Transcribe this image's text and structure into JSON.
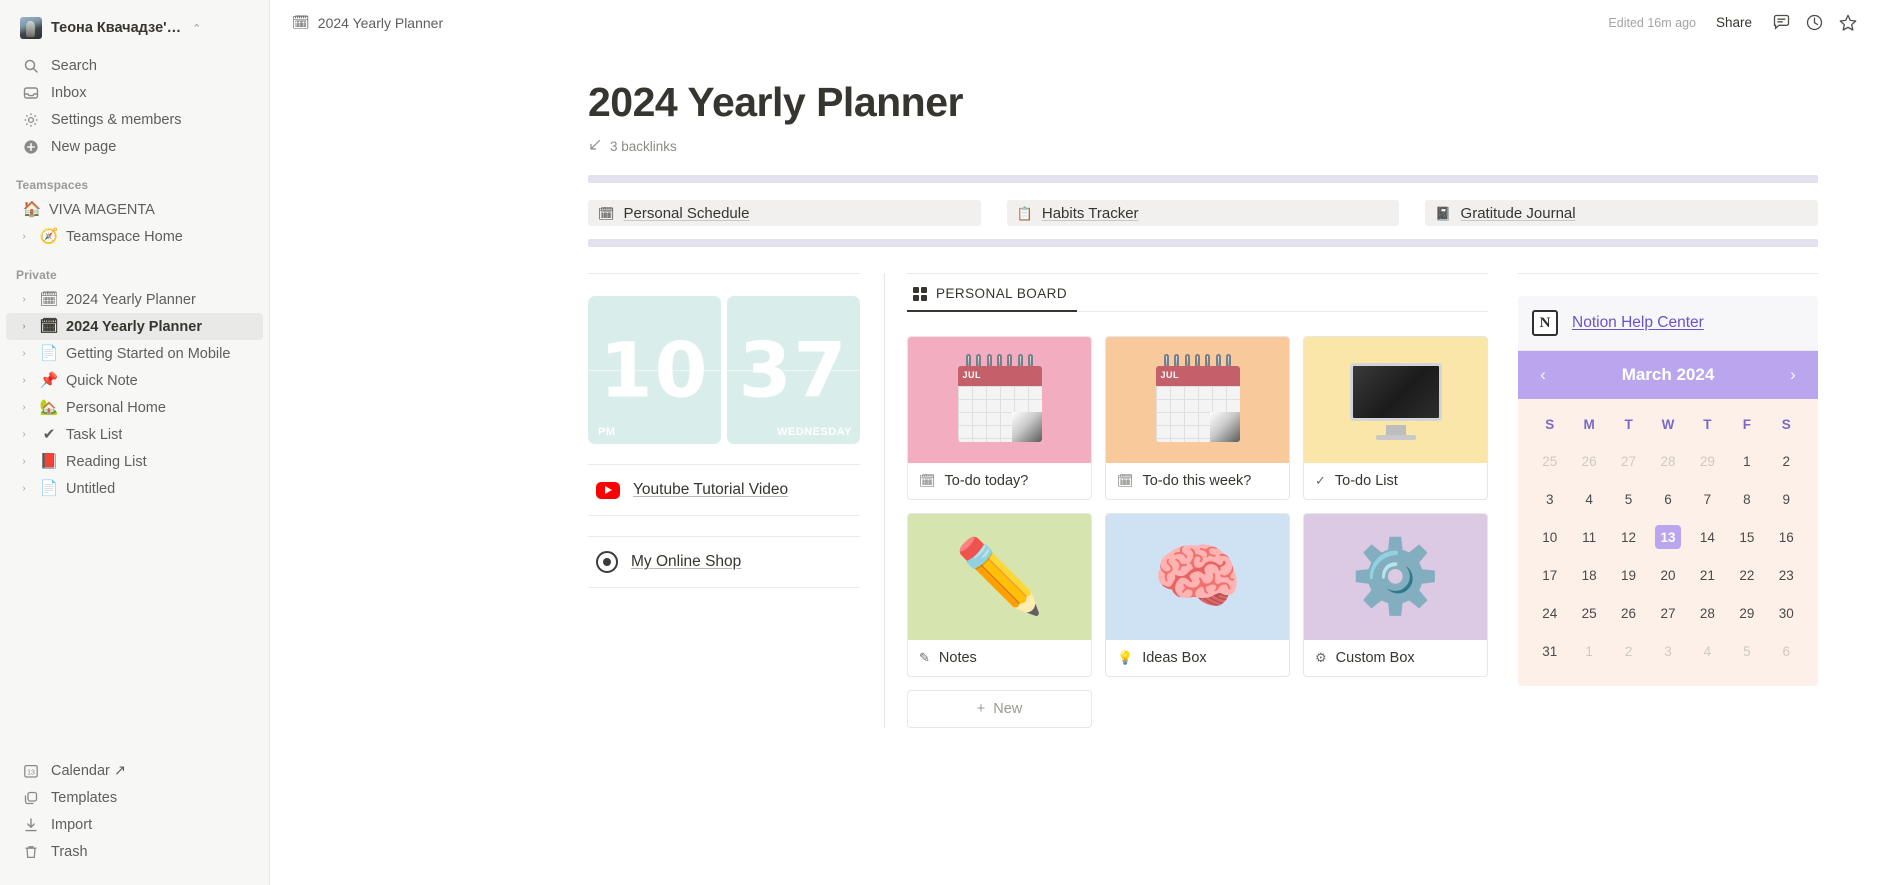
{
  "sidebar": {
    "workspace": {
      "name": "Теона Квачадзе'…",
      "caret": "⌃⌄"
    },
    "nav": [
      {
        "label": "Search",
        "icon": "search-icon"
      },
      {
        "label": "Inbox",
        "icon": "inbox-icon"
      },
      {
        "label": "Settings & members",
        "icon": "gear-icon"
      },
      {
        "label": "New page",
        "icon": "plus-circle-icon"
      }
    ],
    "teamspaces_title": "Teamspaces",
    "teamspaces": [
      {
        "label": "VIVA MAGENTA",
        "emoji": "🏠",
        "arrow": false
      },
      {
        "label": "Teamspace Home",
        "emoji": "🧭",
        "arrow": true
      }
    ],
    "private_title": "Private",
    "private": [
      {
        "label": "2024 Yearly Planner",
        "emoji": "🗓",
        "arrow": true,
        "active": false
      },
      {
        "label": "2024 Yearly Planner",
        "emoji": "🗓",
        "arrow": true,
        "active": true
      },
      {
        "label": "Getting Started on Mobile",
        "emoji": "📄",
        "arrow": true,
        "active": false
      },
      {
        "label": "Quick Note",
        "emoji": "📌",
        "arrow": true,
        "active": false
      },
      {
        "label": "Personal Home",
        "emoji": "🏡",
        "arrow": true,
        "active": false
      },
      {
        "label": "Task List",
        "emoji": "✔",
        "arrow": true,
        "active": false
      },
      {
        "label": "Reading List",
        "emoji": "📕",
        "arrow": true,
        "active": false
      },
      {
        "label": "Untitled",
        "emoji": "📄",
        "arrow": true,
        "active": false
      }
    ],
    "bottom": [
      {
        "label": "Calendar ↗",
        "icon": "calendar-13-icon"
      },
      {
        "label": "Templates",
        "icon": "templates-icon"
      },
      {
        "label": "Import",
        "icon": "import-icon"
      },
      {
        "label": "Trash",
        "icon": "trash-icon"
      }
    ]
  },
  "topbar": {
    "breadcrumb": "2024 Yearly Planner",
    "breadcrumb_emoji": "🗓",
    "edited": "Edited 16m ago",
    "share": "Share"
  },
  "page": {
    "title": "2024 Yearly Planner",
    "backlinks": "3 backlinks",
    "nav_cards": [
      {
        "label": "Personal Schedule",
        "emoji": "🗓"
      },
      {
        "label": "Habits Tracker",
        "emoji": "📋"
      },
      {
        "label": "Gratitude Journal",
        "emoji": "📓"
      }
    ]
  },
  "clock": {
    "hours": "10",
    "minutes": "37",
    "meridiem": "PM",
    "weekday": "WEDNESDAY"
  },
  "links": [
    {
      "label": "Youtube Tutorial Video",
      "icon": "youtube-icon"
    },
    {
      "label": "My Online Shop",
      "icon": "shop-icon"
    }
  ],
  "board": {
    "tab_label": "PERSONAL BOARD",
    "new_label": "New",
    "cards": [
      {
        "label": "To-do today?",
        "cover": "#f2aec0",
        "art": "calendar",
        "foot_icon": "🗓",
        "month": "JUL"
      },
      {
        "label": "To-do this week?",
        "cover": "#f7c99b",
        "art": "calendar",
        "foot_icon": "🗓",
        "month": "JUL"
      },
      {
        "label": "To-do List",
        "cover": "#f9e6a8",
        "art": "monitor",
        "foot_icon": "✓",
        "month": ""
      },
      {
        "label": "Notes",
        "cover": "#d6e4b0",
        "art": "pencil",
        "foot_icon": "✎",
        "month": ""
      },
      {
        "label": "Ideas Box",
        "cover": "#cfe2f3",
        "art": "brain",
        "foot_icon": "💡",
        "month": ""
      },
      {
        "label": "Custom Box",
        "cover": "#dcc9e3",
        "art": "gear",
        "foot_icon": "⚙",
        "month": ""
      }
    ]
  },
  "help_card": {
    "label": "Notion Help Center",
    "logo": "N"
  },
  "calendar": {
    "title": "March 2024",
    "prev": "‹",
    "next": "›",
    "dow": [
      "S",
      "M",
      "T",
      "W",
      "T",
      "F",
      "S"
    ],
    "today": 13,
    "weeks": [
      [
        {
          "d": 25,
          "mute": true
        },
        {
          "d": 26,
          "mute": true
        },
        {
          "d": 27,
          "mute": true
        },
        {
          "d": 28,
          "mute": true
        },
        {
          "d": 29,
          "mute": true
        },
        {
          "d": 1,
          "mute": false
        },
        {
          "d": 2,
          "mute": false
        }
      ],
      [
        {
          "d": 3,
          "mute": false
        },
        {
          "d": 4,
          "mute": false
        },
        {
          "d": 5,
          "mute": false
        },
        {
          "d": 6,
          "mute": false
        },
        {
          "d": 7,
          "mute": false
        },
        {
          "d": 8,
          "mute": false
        },
        {
          "d": 9,
          "mute": false
        }
      ],
      [
        {
          "d": 10,
          "mute": false
        },
        {
          "d": 11,
          "mute": false
        },
        {
          "d": 12,
          "mute": false
        },
        {
          "d": 13,
          "mute": false
        },
        {
          "d": 14,
          "mute": false
        },
        {
          "d": 15,
          "mute": false
        },
        {
          "d": 16,
          "mute": false
        }
      ],
      [
        {
          "d": 17,
          "mute": false
        },
        {
          "d": 18,
          "mute": false
        },
        {
          "d": 19,
          "mute": false
        },
        {
          "d": 20,
          "mute": false
        },
        {
          "d": 21,
          "mute": false
        },
        {
          "d": 22,
          "mute": false
        },
        {
          "d": 23,
          "mute": false
        }
      ],
      [
        {
          "d": 24,
          "mute": false
        },
        {
          "d": 25,
          "mute": false
        },
        {
          "d": 26,
          "mute": false
        },
        {
          "d": 27,
          "mute": false
        },
        {
          "d": 28,
          "mute": false
        },
        {
          "d": 29,
          "mute": false
        },
        {
          "d": 30,
          "mute": false
        }
      ],
      [
        {
          "d": 31,
          "mute": false
        },
        {
          "d": 1,
          "mute": true
        },
        {
          "d": 2,
          "mute": true
        },
        {
          "d": 3,
          "mute": true
        },
        {
          "d": 4,
          "mute": true
        },
        {
          "d": 5,
          "mute": true
        },
        {
          "d": 6,
          "mute": true
        }
      ]
    ]
  }
}
